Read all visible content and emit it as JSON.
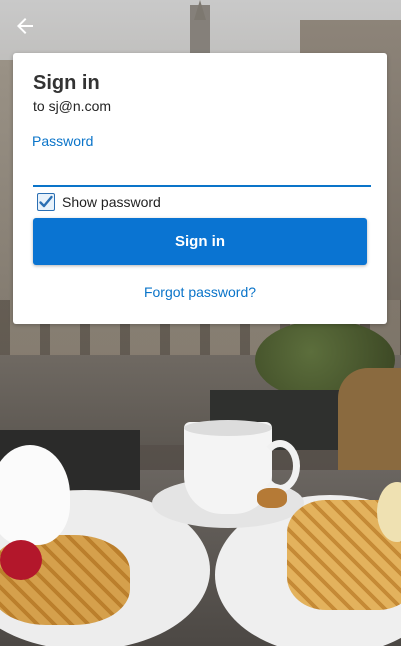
{
  "nav": {
    "back_icon": "arrow-left-icon"
  },
  "signin": {
    "title": "Sign in",
    "account": "to sj@n.com",
    "password_label": "Password",
    "password_value": "",
    "show_password_label": "Show password",
    "show_password_checked": true,
    "signin_button": "Sign in",
    "forgot_link": "Forgot password?"
  },
  "colors": {
    "accent": "#0a74d2",
    "link": "#0a74c9",
    "card_bg": "#ffffff"
  }
}
